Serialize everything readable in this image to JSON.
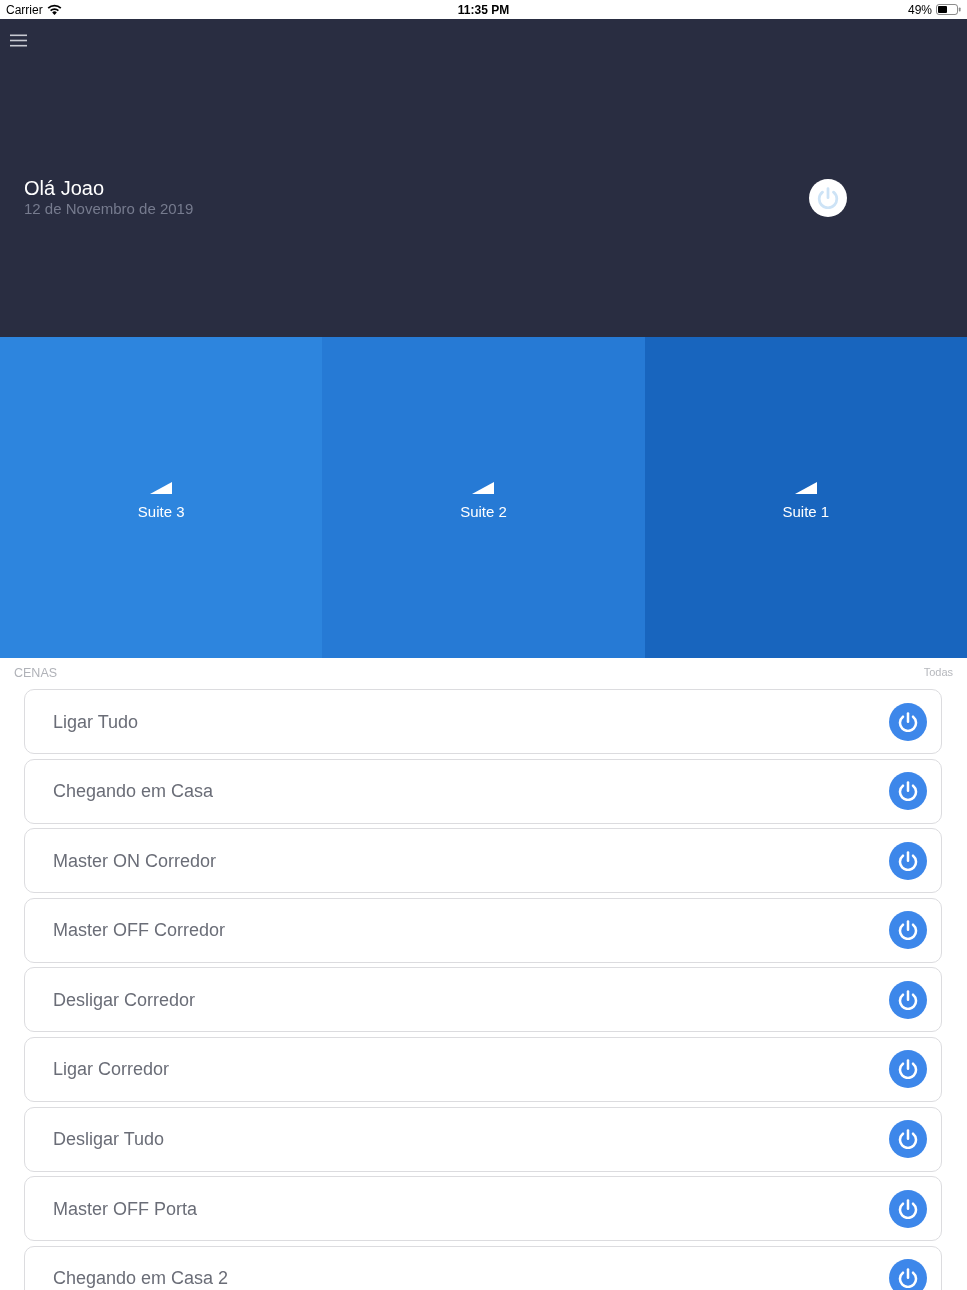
{
  "status_bar": {
    "carrier": "Carrier",
    "time": "11:35 PM",
    "battery": "49%"
  },
  "header": {
    "greeting": "Olá Joao",
    "date": "12 de Novembro de 2019"
  },
  "rooms": [
    {
      "name": "Suite 3",
      "color": "#2d85de"
    },
    {
      "name": "Suite 2",
      "color": "#267ad5"
    },
    {
      "name": "Suite 1",
      "color": "#1865be"
    }
  ],
  "scenes": {
    "title": "CENAS",
    "link": "Todas",
    "items": [
      "Ligar Tudo",
      "Chegando em Casa",
      "Master ON Corredor",
      "Master OFF Corredor",
      "Desligar Corredor",
      "Ligar Corredor",
      "Desligar Tudo",
      "Master OFF Porta",
      "Chegando em Casa 2"
    ]
  }
}
